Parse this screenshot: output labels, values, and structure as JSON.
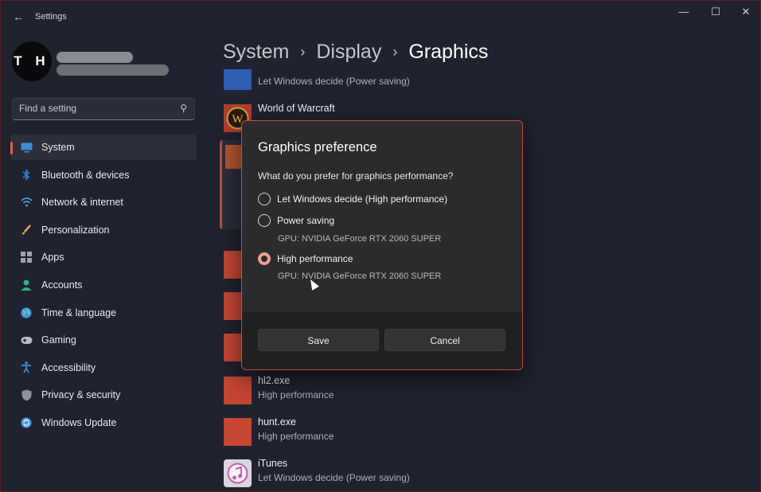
{
  "window": {
    "title": "Settings"
  },
  "controls": {
    "minimize": "—",
    "maximize": "☐",
    "close": "✕"
  },
  "profile": {
    "initials": "T H"
  },
  "search": {
    "placeholder": "Find a setting"
  },
  "nav": {
    "items": [
      {
        "label": "System",
        "icon": "monitor-icon",
        "color": "#3b8fd9",
        "active": true
      },
      {
        "label": "Bluetooth & devices",
        "icon": "bluetooth-icon",
        "color": "#2f7ce0"
      },
      {
        "label": "Network & internet",
        "icon": "wifi-icon",
        "color": "#4aa3e8"
      },
      {
        "label": "Personalization",
        "icon": "brush-icon",
        "color": "#e8a25a"
      },
      {
        "label": "Apps",
        "icon": "apps-grid-icon",
        "color": "#9aa3b5"
      },
      {
        "label": "Accounts",
        "icon": "person-icon",
        "color": "#2fb57a"
      },
      {
        "label": "Time & language",
        "icon": "globe-icon",
        "color": "#3fa0e0"
      },
      {
        "label": "Gaming",
        "icon": "gamepad-icon",
        "color": "#b6b9c2"
      },
      {
        "label": "Accessibility",
        "icon": "accessibility-icon",
        "color": "#3f8fe6"
      },
      {
        "label": "Privacy & security",
        "icon": "shield-icon",
        "color": "#8d92a0"
      },
      {
        "label": "Windows Update",
        "icon": "sync-icon",
        "color": "#3f9be6"
      }
    ]
  },
  "breadcrumb": {
    "part1": "System",
    "part2": "Display",
    "current": "Graphics",
    "separator": "›"
  },
  "apps": [
    {
      "name": "",
      "pref": "Let Windows decide (Power saving)",
      "tile": "#2a5fb4"
    },
    {
      "name": "World of Warcraft",
      "pref": "",
      "tile": "#b43c2a"
    },
    {
      "name": "hl2.exe",
      "pref": "High performance",
      "tile": "#c64630"
    },
    {
      "name": "hunt.exe",
      "pref": "High performance",
      "tile": "#c64630"
    },
    {
      "name": "iTunes",
      "pref": "Let Windows decide (Power saving)",
      "tile": "#d8d8dc"
    }
  ],
  "dialog": {
    "title": "Graphics preference",
    "question": "What do you prefer for graphics performance?",
    "options": [
      {
        "label": "Let Windows decide (High performance)",
        "note": ""
      },
      {
        "label": "Power saving",
        "note": "GPU: NVIDIA GeForce RTX 2060 SUPER"
      },
      {
        "label": "High performance",
        "note": "GPU: NVIDIA GeForce RTX 2060 SUPER",
        "selected": true
      }
    ],
    "save_label": "Save",
    "cancel_label": "Cancel"
  },
  "colors": {
    "accent": "#ee5a4a",
    "dialog_border": "#c64a44",
    "selected_radio": "#f0a08f"
  }
}
